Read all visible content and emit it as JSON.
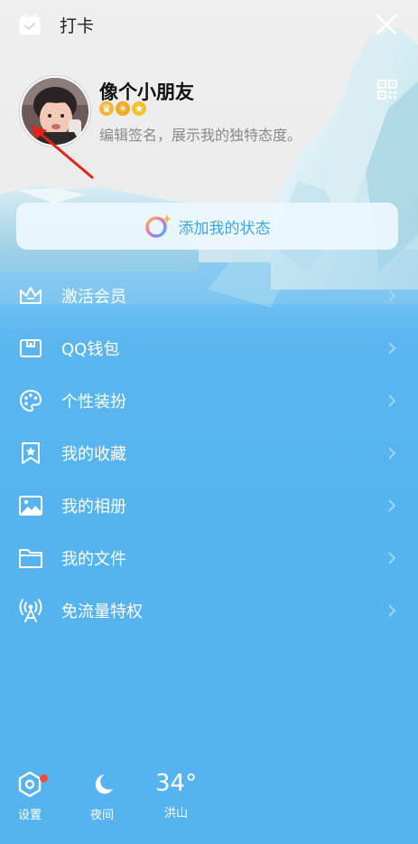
{
  "header": {
    "checkin_label": "打卡",
    "icons": {
      "checkin": "calendar-check-icon",
      "close": "close-icon"
    }
  },
  "profile": {
    "name": "像个小朋友",
    "signature": "编辑签名，展示我的独特态度。",
    "badges": [
      "crown-badge",
      "sun-badge",
      "star-badge"
    ],
    "qr_icon": "qr-code-icon"
  },
  "status": {
    "label": "添加我的状态",
    "icon": "status-ring-icon"
  },
  "menu": {
    "items": [
      {
        "label": "激活会员",
        "icon": "crown-icon"
      },
      {
        "label": "QQ钱包",
        "icon": "wallet-icon"
      },
      {
        "label": "个性装扮",
        "icon": "palette-icon"
      },
      {
        "label": "我的收藏",
        "icon": "bookmark-star-icon"
      },
      {
        "label": "我的相册",
        "icon": "image-icon"
      },
      {
        "label": "我的文件",
        "icon": "folder-icon"
      },
      {
        "label": "免流量特权",
        "icon": "broadcast-icon"
      }
    ]
  },
  "footer": {
    "settings_label": "设置",
    "night_label": "夜间",
    "weather": {
      "temp": "34°",
      "city": "洪山"
    }
  },
  "colors": {
    "menu_background": "#55b4f0",
    "status_text": "#3aa7e6",
    "notification_dot": "#ee4b3c"
  }
}
